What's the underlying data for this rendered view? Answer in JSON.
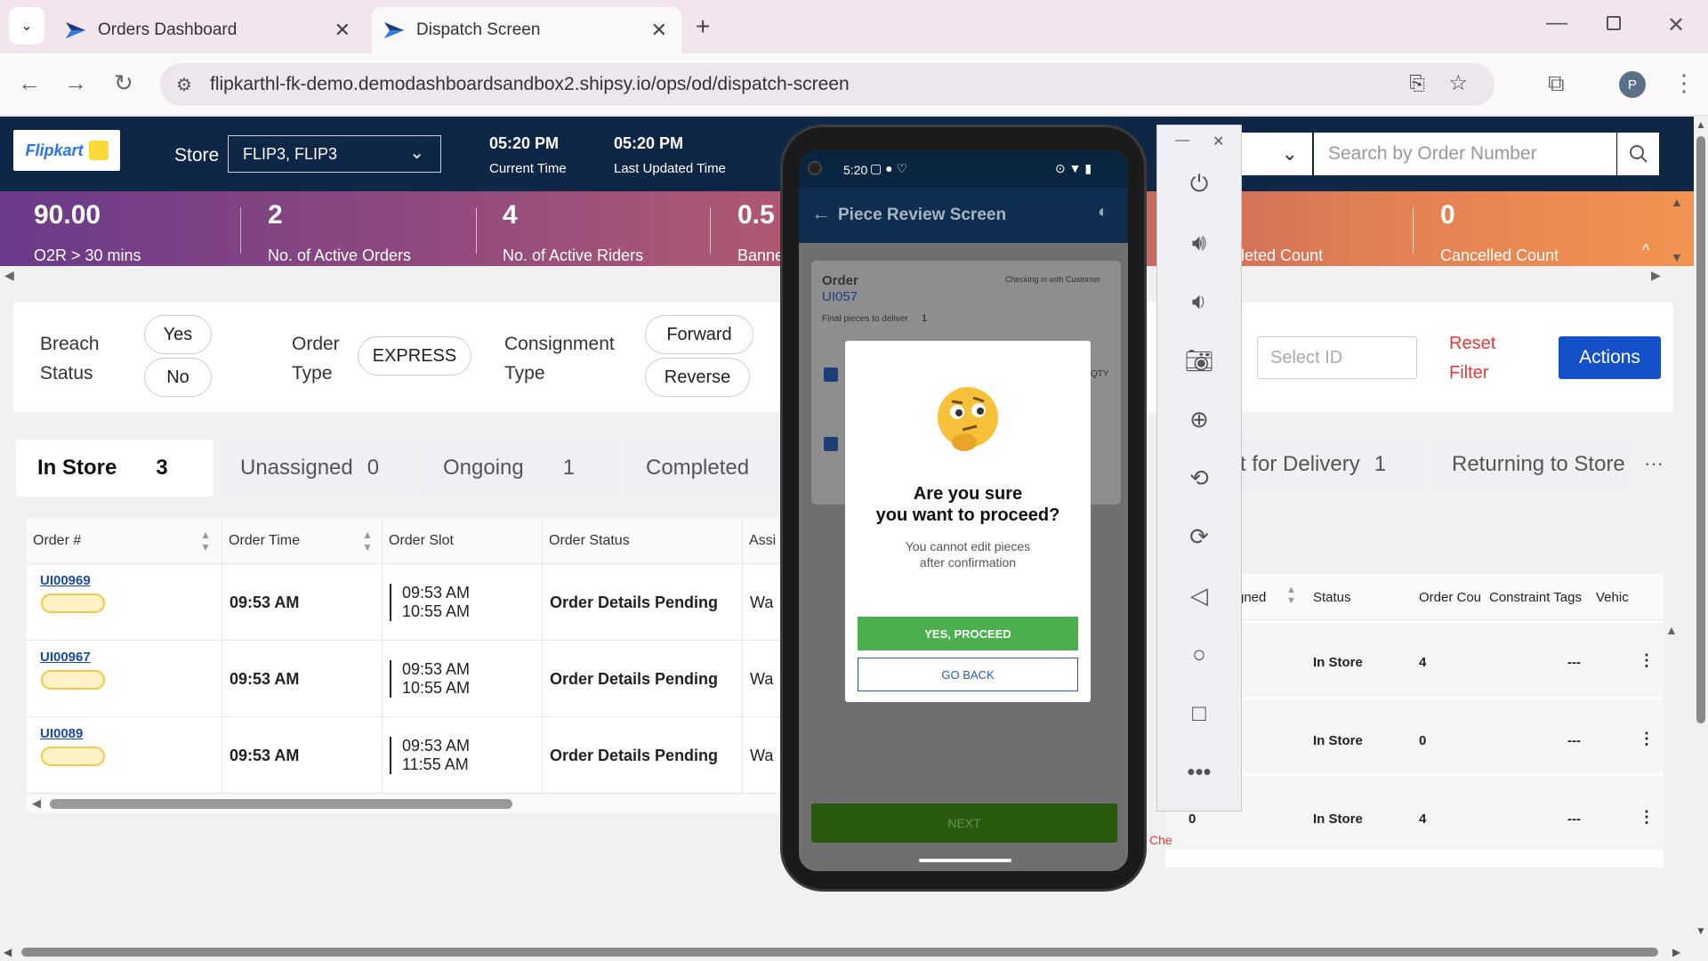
{
  "browser": {
    "tabs": [
      {
        "title": "Orders Dashboard"
      },
      {
        "title": "Dispatch Screen"
      }
    ],
    "url": "flipkarthl-fk-demo.demodashboardsandbox2.shipsy.io/ops/od/dispatch-screen",
    "profile_initial": "P"
  },
  "header": {
    "logo_text": "Flipkart",
    "store_label": "Store",
    "store_value": "FLIP3, FLIP3",
    "current_time": "05:20 PM",
    "current_time_label": "Current Time",
    "updated_time": "05:20 PM",
    "updated_time_label": "Last Updated Time",
    "search_placeholder": "Search by Order Number"
  },
  "stats": [
    {
      "value": "90.00",
      "label": "O2R > 30 mins"
    },
    {
      "value": "2",
      "label": "No. of Active Orders"
    },
    {
      "value": "4",
      "label": "No. of Active Riders"
    },
    {
      "value": "0.5",
      "label": "Banne"
    },
    {
      "value": "",
      "label": "pleted Count"
    },
    {
      "value": "0",
      "label": "Cancelled Count"
    }
  ],
  "filters": {
    "breach_label_1": "Breach",
    "breach_label_2": "Status",
    "yes": "Yes",
    "no": "No",
    "order_type_1": "Order",
    "order_type_2": "Type",
    "express": "EXPRESS",
    "consignment_1": "Consignment",
    "consignment_2": "Type",
    "forward": "Forward",
    "reverse": "Reverse",
    "select_id_placeholder": "Select ID",
    "reset_1": "Reset",
    "reset_2": "Filter",
    "actions": "Actions"
  },
  "tabs": [
    {
      "label": "In Store",
      "count": "3"
    },
    {
      "label": "Unassigned",
      "count": "0"
    },
    {
      "label": "Ongoing",
      "count": "1"
    },
    {
      "label": "Completed",
      "count": ""
    },
    {
      "label": "t for Delivery",
      "count": "1"
    },
    {
      "label": "Returning to Store",
      "count": ""
    }
  ],
  "more_tabs": "···",
  "left_table": {
    "headers": [
      "Order #",
      "Order Time",
      "Order Slot",
      "Order Status",
      "Assi"
    ],
    "rows": [
      {
        "order": "UI00969",
        "time": "09:53 AM",
        "slot_start": "09:53 AM",
        "slot_end": "10:55 AM",
        "status": "Order Details Pending",
        "assign": "Wa"
      },
      {
        "order": "UI00967",
        "time": "09:53 AM",
        "slot_start": "09:53 AM",
        "slot_end": "10:55 AM",
        "status": "Order Details Pending",
        "assign": "Wa"
      },
      {
        "order": "UI0089",
        "time": "09:53 AM",
        "slot_start": "09:53 AM",
        "slot_end": "11:55 AM",
        "status": "Order Details Pending",
        "assign": "Wa"
      }
    ]
  },
  "right_table": {
    "headers": [
      "gned",
      "Status",
      "Order Cou",
      "Constraint Tags",
      "Vehic"
    ],
    "rows": [
      {
        "assigned": "",
        "status": "In Store",
        "count": "4",
        "tags": "---"
      },
      {
        "assigned": "",
        "status": "In Store",
        "count": "0",
        "tags": "---"
      },
      {
        "assigned": "0",
        "status": "In Store",
        "count": "4",
        "tags": "---"
      }
    ],
    "side_text": "Che"
  },
  "phone": {
    "status_time": "5:20",
    "app_title": "Piece Review Screen",
    "order_label": "Order",
    "order_id": "UI057",
    "order_status": "Checking in with Customer",
    "final_pieces": "Final pieces to deliver",
    "final_pieces_count": "1",
    "qty_label": "QTY",
    "modal_title_1": "Are you sure",
    "modal_title_2": "you want to proceed?",
    "modal_sub_1": "You cannot edit pieces",
    "modal_sub_2": "after confirmation",
    "proceed": "YES, PROCEED",
    "go_back": "GO BACK",
    "next": "NEXT"
  },
  "colors": {
    "header_bg": "#0e2746",
    "accent_blue": "#1450c8",
    "proceed_green": "#4caf4f",
    "reset_red": "#e53935"
  }
}
